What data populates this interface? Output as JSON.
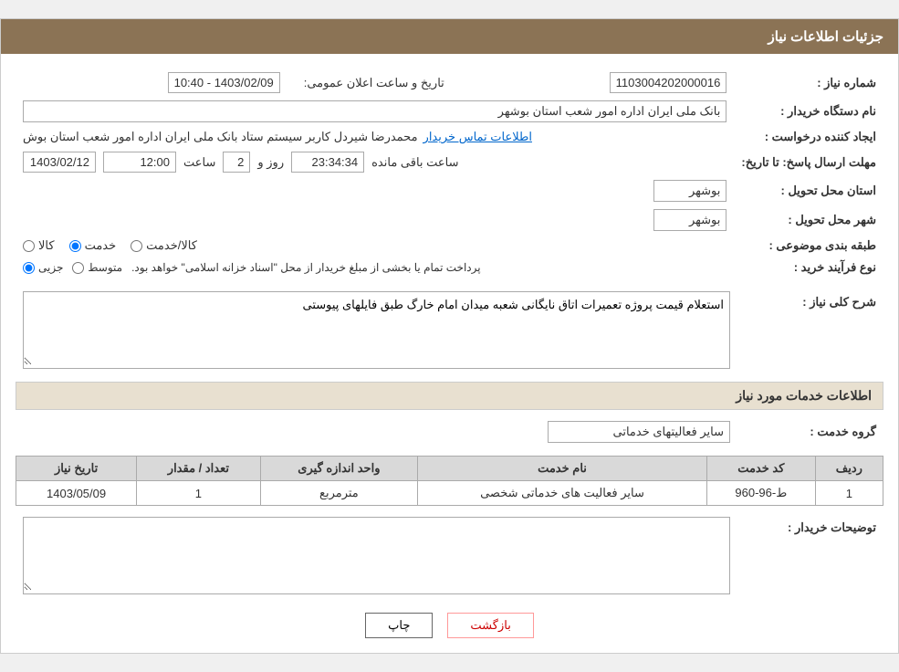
{
  "header": {
    "title": "جزئیات اطلاعات نیاز"
  },
  "fields": {
    "need_number_label": "شماره نیاز :",
    "need_number_value": "1103004202000016",
    "buyer_org_label": "نام دستگاه خریدار :",
    "buyer_org_value": "بانک ملی ایران اداره امور شعب استان بوشهر",
    "requester_label": "ایجاد کننده درخواست :",
    "requester_name": "محمدرضا شیردل کاربر سیستم ستاد بانک ملی ایران اداره امور شعب استان بوش",
    "requester_contact_link": "اطلاعات تماس خریدار",
    "send_deadline_label": "مهلت ارسال پاسخ: تا تاریخ:",
    "send_deadline_date": "1403/02/12",
    "send_deadline_time": "12:00",
    "send_deadline_days": "2",
    "send_deadline_remaining": "23:34:34",
    "send_deadline_time_label": "ساعت",
    "send_deadline_day_label": "روز و",
    "send_deadline_remaining_label": "ساعت باقی مانده",
    "delivery_province_label": "استان محل تحویل :",
    "delivery_province_value": "بوشهر",
    "delivery_city_label": "شهر محل تحویل :",
    "delivery_city_value": "بوشهر",
    "category_label": "طبقه بندی موضوعی :",
    "category_options": [
      {
        "label": "کالا",
        "value": "kala"
      },
      {
        "label": "خدمت",
        "value": "khedmat"
      },
      {
        "label": "کالا/خدمت",
        "value": "kala_khedmat"
      }
    ],
    "category_selected": "khedmat",
    "purchase_type_label": "نوع فرآیند خرید :",
    "purchase_type_options": [
      {
        "label": "جزیی",
        "value": "jozi"
      },
      {
        "label": "متوسط",
        "value": "motavaset"
      }
    ],
    "purchase_type_selected": "jozi",
    "purchase_type_note": "پرداخت تمام یا بخشی از مبلغ خریدار از محل \"اسناد خزانه اسلامی\" خواهد بود.",
    "announcement_date_label": "تاریخ و ساعت اعلان عمومی:",
    "announcement_date_value": "1403/02/09 - 10:40",
    "general_desc_label": "شرح کلی نیاز :",
    "general_desc_value": "استعلام قیمت پروژه تعمیرات اتاق نایگانی شعبه میدان امام خارگ طبق فایلهای پیوستی",
    "services_section_title": "اطلاعات خدمات مورد نیاز",
    "service_group_label": "گروه خدمت :",
    "service_group_value": "سایر فعالیتهای خدماتی",
    "services_table": {
      "columns": [
        "ردیف",
        "کد خدمت",
        "نام خدمت",
        "واحد اندازه گیری",
        "تعداد / مقدار",
        "تاریخ نیاز"
      ],
      "rows": [
        {
          "row_num": "1",
          "code": "ط-96-960",
          "name": "سایر فعالیت های خدماتی شخصی",
          "unit": "مترمربع",
          "quantity": "1",
          "date": "1403/05/09"
        }
      ]
    },
    "buyer_desc_label": "توضیحات خریدار :",
    "buyer_desc_value": "",
    "buttons": {
      "print": "چاپ",
      "back": "بازگشت"
    }
  }
}
